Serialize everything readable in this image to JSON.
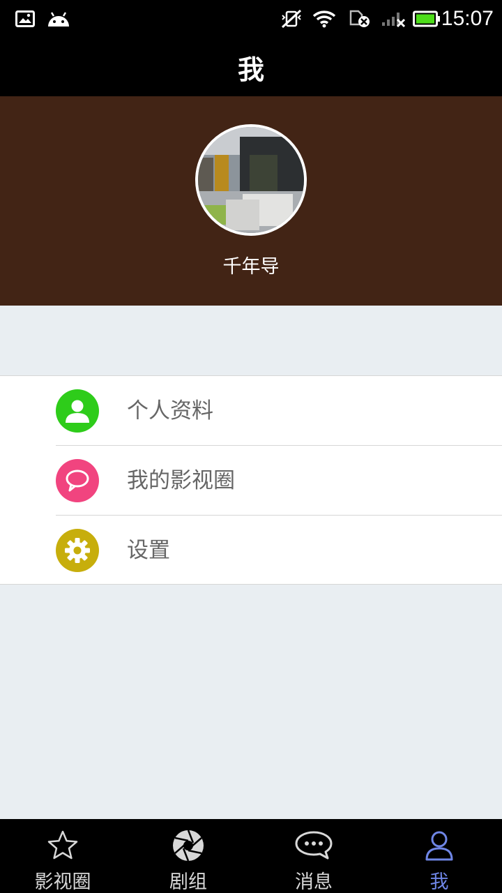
{
  "status_bar": {
    "time": "15:07",
    "icons": [
      "image-icon",
      "android-icon",
      "mute-vibrate-icon",
      "wifi-icon",
      "sim-error-icon",
      "signal-icon",
      "battery-icon"
    ],
    "battery_level": 1.0
  },
  "header": {
    "title": "我"
  },
  "profile": {
    "username": "千年导",
    "avatar_icon": "avatar-photo"
  },
  "menu": {
    "items": [
      {
        "label": "个人资料",
        "icon": "person-icon",
        "color": "#2ecc1a"
      },
      {
        "label": "我的影视圈",
        "icon": "chat-bubble-icon",
        "color": "#f1447f"
      },
      {
        "label": "设置",
        "icon": "gear-icon",
        "color": "#c7ae0c"
      }
    ]
  },
  "bottom_nav": {
    "active_color": "#6f86e6",
    "items": [
      {
        "label": "影视圈",
        "icon": "star-icon",
        "active": false
      },
      {
        "label": "剧组",
        "icon": "aperture-icon",
        "active": false
      },
      {
        "label": "消息",
        "icon": "message-icon",
        "active": false
      },
      {
        "label": "我",
        "icon": "user-icon",
        "active": true
      }
    ]
  },
  "colors": {
    "status_bar_bg": "#000000",
    "profile_bg": "#422415",
    "page_bg": "#e9eef2"
  }
}
